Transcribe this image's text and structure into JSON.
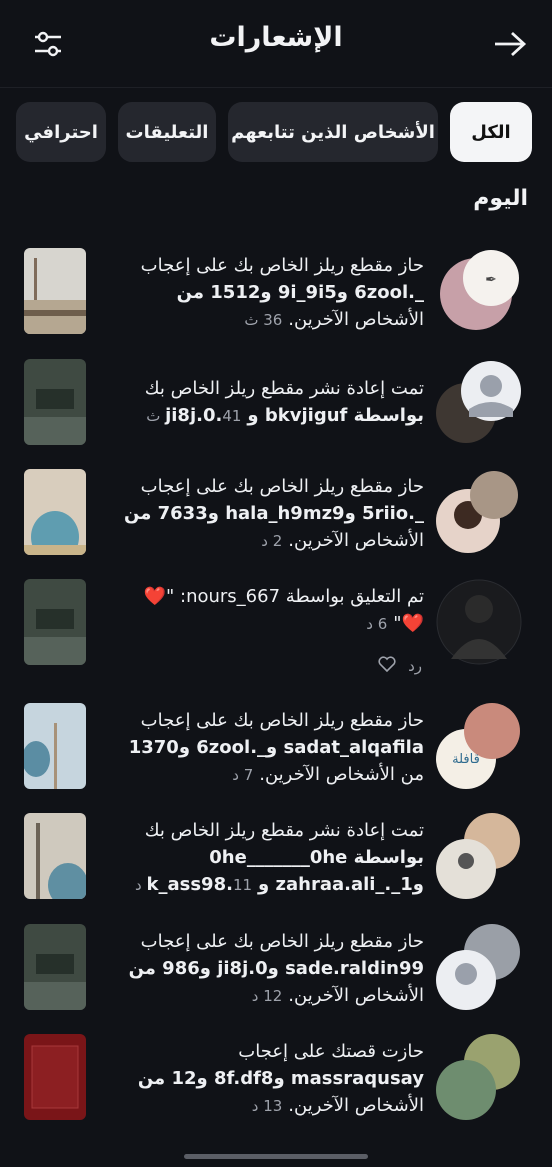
{
  "header": {
    "title": "الإشعارات",
    "back_icon": "arrow-right-icon",
    "filter_icon": "sliders-icon"
  },
  "tabs": [
    {
      "label": "الكل",
      "active": true
    },
    {
      "label": "الأشخاص الذين تتابعهم",
      "active": false
    },
    {
      "label": "التعليقات",
      "active": false
    },
    {
      "label": "احترافي",
      "active": false
    }
  ],
  "section": {
    "today": "اليوم"
  },
  "notifications": [
    {
      "lines": [
        "حاز مقطع ريلز الخاص بك على إعجاب",
        "_.6zool و9i_9i5 و1512 من",
        "الأشخاص الآخرين."
      ],
      "time": "36 ث"
    },
    {
      "lines": [
        "تمت إعادة نشر مقطع ريلز الخاص بك",
        "بواسطة bkvjiguf وji8j.0."
      ],
      "time": "41 ث"
    },
    {
      "lines": [
        "حاز مقطع ريلز الخاص بك على إعجاب",
        "_.5riio وhala_h9mz9 و7633 من",
        "الأشخاص الآخرين."
      ],
      "time": "2 د"
    },
    {
      "lines": [
        "تم التعليق بواسطة nours_667: \"❤️",
        "❤️\""
      ],
      "time": "6 د",
      "reply": "رد"
    },
    {
      "lines": [
        "حاز مقطع ريلز الخاص بك على إعجاب",
        "sadat_alqafila و_.6zool و1370",
        "من الأشخاص الآخرين."
      ],
      "time": "7 د"
    },
    {
      "lines": [
        "تمت إعادة نشر مقطع ريلز الخاص بك",
        "بواسطة 0he_______0he",
        "وzahraa.ali_._1 وk_ass98."
      ],
      "time": "11 د"
    },
    {
      "lines": [
        "حاز مقطع ريلز الخاص بك على إعجاب",
        "sade.raldin99 وji8j.0 و986 من",
        "الأشخاص الآخرين."
      ],
      "time": "12 د"
    },
    {
      "lines": [
        "حازت قصتك على إعجاب",
        "massraqusay و8f.df8 و12 من",
        "الأشخاص الآخرين."
      ],
      "time": "13 د"
    }
  ],
  "colors": {
    "background": "#101217",
    "chip": "#25272e",
    "active_chip": "#f4f5f7",
    "secondary_text": "#9ea2ab"
  }
}
